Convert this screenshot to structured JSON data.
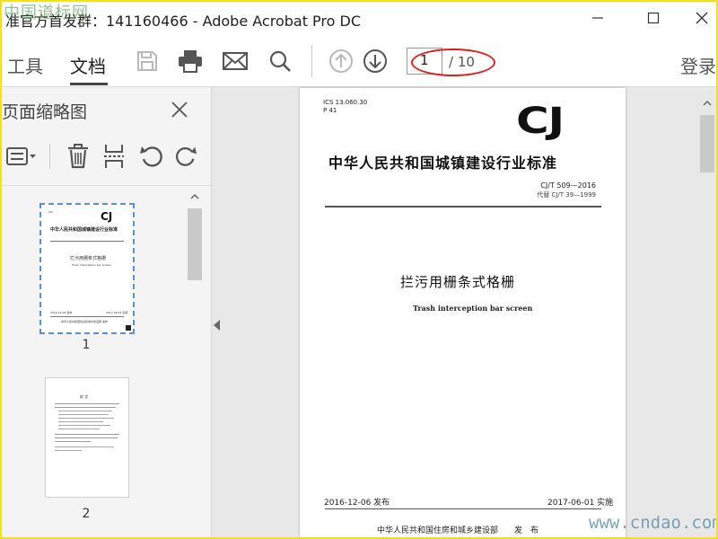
{
  "window": {
    "title": "准官方首发群：141160466 - Adobe Acrobat Pro DC",
    "watermark_top": "中国道标网",
    "watermark_bottom": "www.cndao.com"
  },
  "toolbar": {
    "tabs": [
      {
        "label": "工具"
      },
      {
        "label": "文档",
        "active": true
      }
    ],
    "icons": [
      "save-icon",
      "print-icon",
      "email-icon",
      "search-icon",
      "page-up-icon",
      "page-down-icon"
    ],
    "page_current": "1",
    "page_total": "/ 10",
    "login_label": "登录"
  },
  "left_panel": {
    "title": "页面缩略图",
    "tools": [
      "options-menu-icon",
      "delete-icon",
      "extract-icon",
      "rotate-left-icon",
      "rotate-right-icon"
    ],
    "thumbnails": [
      {
        "label": "1",
        "logo": "CJ",
        "org": "中华人民共和国城镇建设行业标准",
        "title": "拦污用栅条式格栅",
        "subtitle": "Trash interception bar screen",
        "footer_left": "2016-12-06 发布",
        "footer_right": "2017-06-01 实施",
        "issuer": "中华人民共和国住房和城乡建设部 发布"
      },
      {
        "label": "2",
        "heading": "前  言"
      }
    ]
  },
  "document": {
    "ics": "ICS 13.060.30",
    "p": "P 41",
    "logo": "CJ",
    "org": "中华人民共和国城镇建设行业标准",
    "code": "CJ/T 509—2016",
    "replaces": "代替 CJ/T 39—1999",
    "title": "拦污用栅条式格栅",
    "subtitle": "Trash interception bar screen",
    "release_date": "2016-12-06 发布",
    "effective_date": "2017-06-01 实施",
    "issuer": "中华人民共和国住房和城乡建设部　　发　布"
  },
  "colors": {
    "frame": "#f2e21a",
    "annotation_oval": "#d8201f",
    "thumb_selected": "#5a8fd0"
  }
}
